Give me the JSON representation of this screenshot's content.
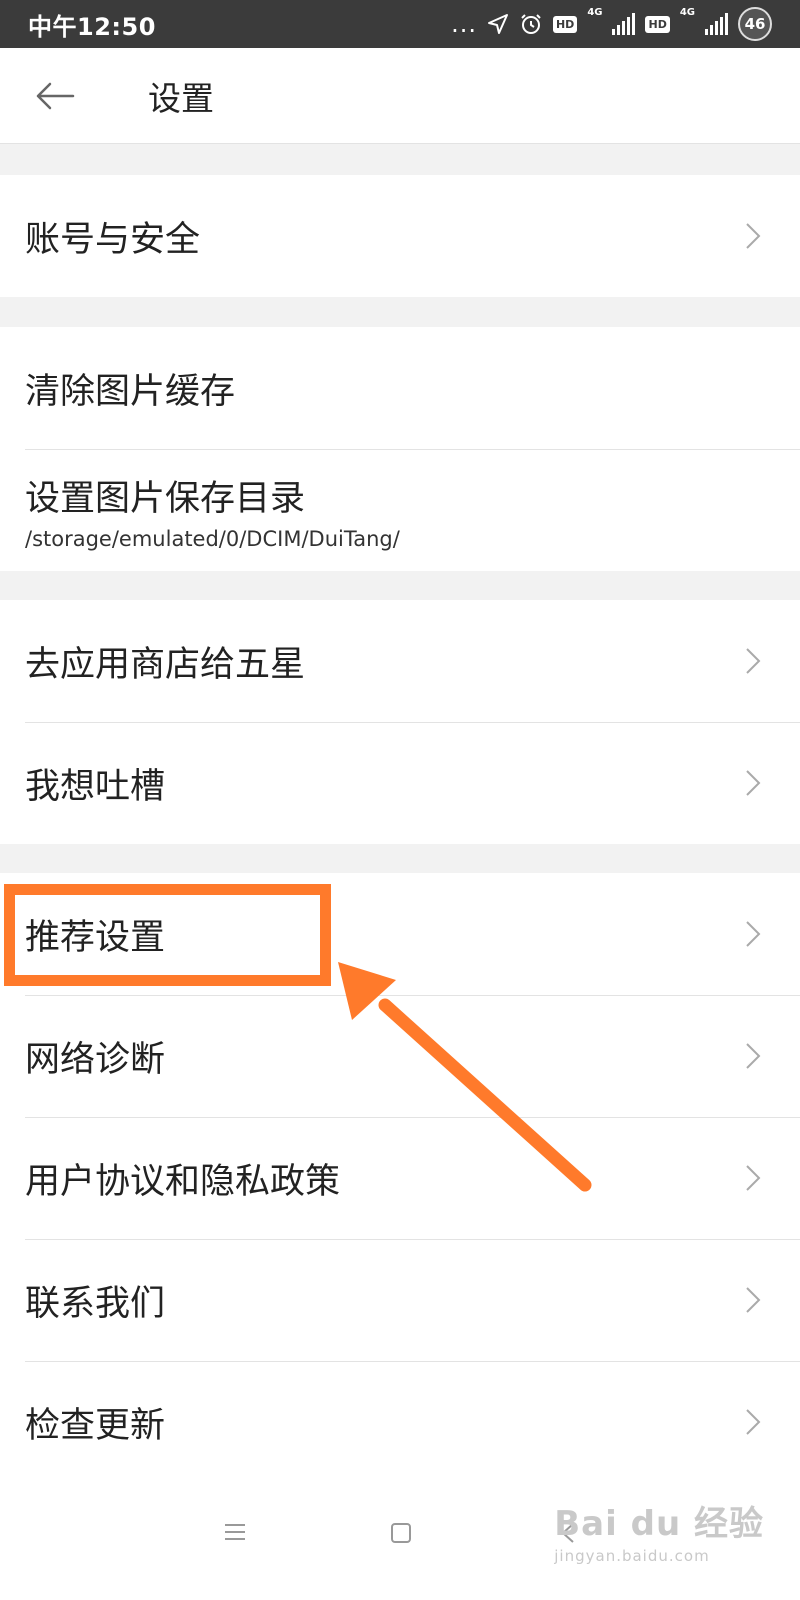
{
  "status_bar": {
    "time": "中午12:50",
    "dots": "...",
    "hd_badge": "HD",
    "network": "4G",
    "battery": "46"
  },
  "header": {
    "title": "设置"
  },
  "groups": [
    {
      "items": [
        {
          "label": "账号与安全"
        }
      ]
    },
    {
      "items": [
        {
          "label": "清除图片缓存"
        },
        {
          "label": "设置图片保存目录",
          "sublabel": "/storage/emulated/0/DCIM/DuiTang/"
        }
      ]
    },
    {
      "items": [
        {
          "label": "去应用商店给五星"
        },
        {
          "label": "我想吐槽"
        }
      ]
    },
    {
      "items": [
        {
          "label": "推荐设置"
        },
        {
          "label": "网络诊断"
        },
        {
          "label": "用户协议和隐私政策"
        },
        {
          "label": "联系我们"
        },
        {
          "label": "检查更新"
        }
      ]
    }
  ],
  "annotation": {
    "color": "#ff7a2b"
  },
  "watermark": {
    "main": "Bai du 经验",
    "sub": "jingyan.baidu.com"
  }
}
